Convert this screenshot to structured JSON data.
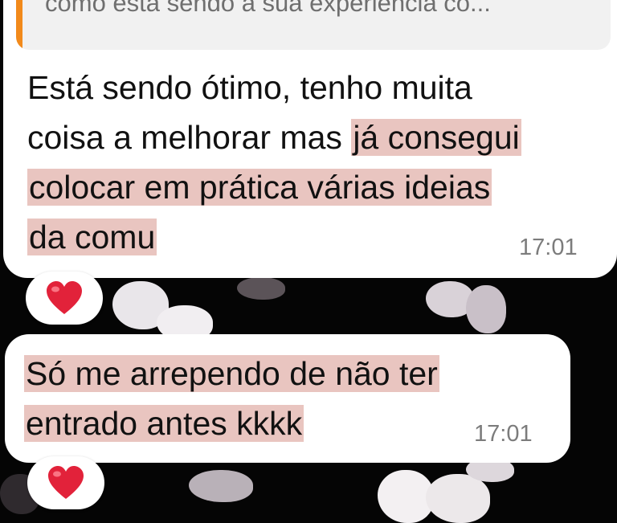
{
  "colors": {
    "quote_accent": "#f28a1b",
    "highlight": "#e9c5c0",
    "bubble": "#ffffff",
    "wallpaper": "#050505"
  },
  "chat": {
    "messages": [
      {
        "quoted_text": "como está sendo a sua experiência co...",
        "lines": [
          "Está sendo ótimo, tenho muita",
          "coisa a melhorar mas ",
          "já consegui",
          "colocar em prática várias ideias",
          "da comu"
        ],
        "time": "17:01",
        "reaction": "heart-emoji"
      },
      {
        "lines": [
          "Só me arrependo de não ter",
          "entrado antes kkkk"
        ],
        "time": "17:01",
        "reaction": "heart-emoji"
      }
    ]
  }
}
